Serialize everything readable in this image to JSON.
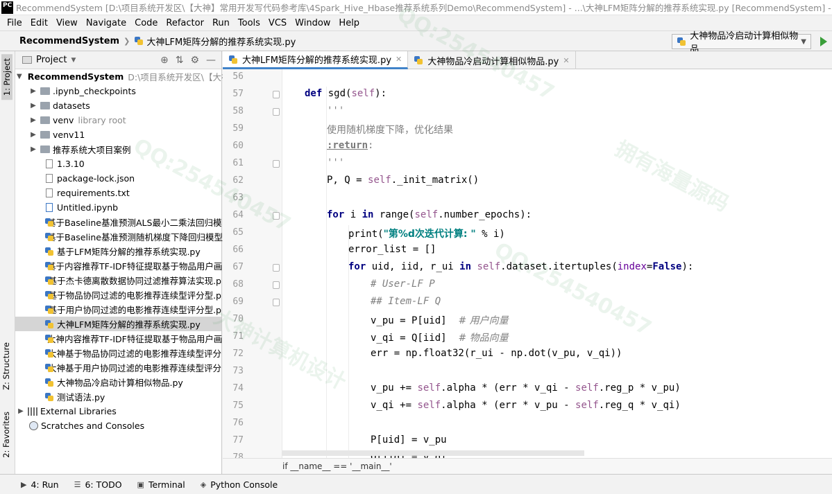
{
  "window": {
    "app_icon": "PC",
    "title": "RecommendSystem [D:\\项目系统开发区\\【大神】常用开发写代码参考库\\4Spark_Hive_Hbase推荐系统系列Demo\\RecommendSystem] - ...\\大神LFM矩阵分解的推荐系统实现.py [RecommendSystem] - PyCharm (A"
  },
  "menu": [
    "File",
    "Edit",
    "View",
    "Navigate",
    "Code",
    "Refactor",
    "Run",
    "Tools",
    "VCS",
    "Window",
    "Help"
  ],
  "nav": {
    "project": "RecommendSystem",
    "file": "大神LFM矩阵分解的推荐系统实现.py",
    "run_config": "大神物品冷启动计算相似物品"
  },
  "left_tabs": {
    "project": "1: Project",
    "structure": "Z: Structure",
    "favorites": "2: Favorites"
  },
  "panel": {
    "title": "Project"
  },
  "tree": {
    "root": {
      "name": "RecommendSystem",
      "path": "D:\\项目系统开发区\\【大神"
    },
    "items": [
      {
        "name": ".ipynb_checkpoints",
        "extra": ""
      },
      {
        "name": "datasets",
        "extra": ""
      },
      {
        "name": "venv",
        "extra": "library root"
      },
      {
        "name": "venv11",
        "extra": ""
      },
      {
        "name": "推荐系统大项目案例",
        "extra": ""
      }
    ],
    "files": [
      "1.3.10",
      "package-lock.json",
      "requirements.txt",
      "Untitled.ipynb",
      "基于Baseline基准预测ALS最小二乘法回归模",
      "基于Baseline基准预测随机梯度下降回归模型",
      "基于LFM矩阵分解的推荐系统实现.py",
      "基于内容推荐TF-IDF特征提取基于物品用户画",
      "基于杰卡德离散数据协同过滤推荐算法实现.p",
      "基于物品协同过滤的电影推荐连续型评分型.p",
      "基于用户协同过滤的电影推荐连续型评分型.p",
      "大神LFM矩阵分解的推荐系统实现.py",
      "大神内容推荐TF-IDF特征提取基于物品用户画",
      "大神基于物品协同过滤的电影推荐连续型评分",
      "大神基于用户协同过滤的电影推荐连续型评分",
      "大神物品冷启动计算相似物品.py",
      "测试语法.py"
    ],
    "external": "External Libraries",
    "scratches": "Scratches and Consoles"
  },
  "tabs": [
    {
      "label": "大神LFM矩阵分解的推荐系统实现.py",
      "active": true
    },
    {
      "label": "大神物品冷启动计算相似物品.py",
      "active": false
    }
  ],
  "editor": {
    "line_numbers": [
      "56",
      "57",
      "58",
      "59",
      "60",
      "61",
      "62",
      "63",
      "64",
      "65",
      "66",
      "67",
      "68",
      "69",
      "70",
      "71",
      "72",
      "73",
      "74",
      "75",
      "76",
      "77",
      "78"
    ],
    "bottom_crumb": "if __name__ == '__main__'"
  },
  "bottom_tools": [
    {
      "icon": "play-icon",
      "label": "4: Run"
    },
    {
      "icon": "todo-icon",
      "label": "6: TODO"
    },
    {
      "icon": "terminal-icon",
      "label": "Terminal"
    },
    {
      "icon": "python-console-icon",
      "label": "Python Console"
    }
  ],
  "watermarks": [
    "QQ:254540457",
    "拥有海量源码",
    "大神计算机设计"
  ]
}
